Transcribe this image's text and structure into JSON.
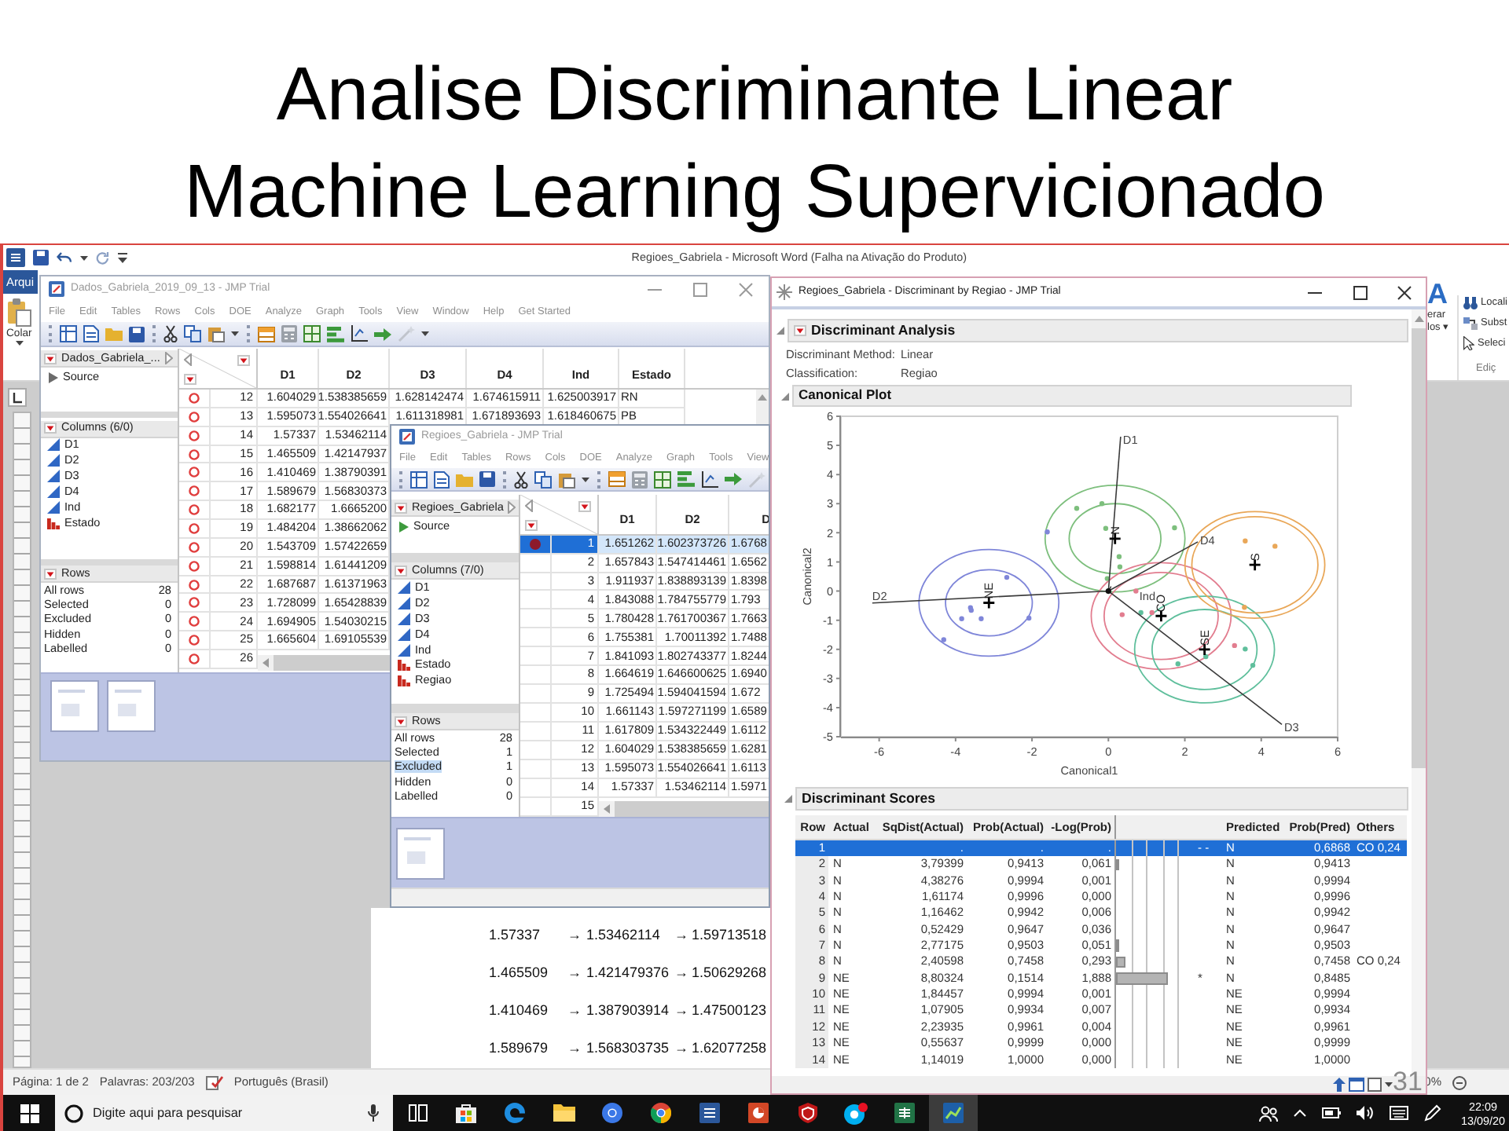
{
  "slide": {
    "title_lines": [
      "Analise Discriminante Linear",
      "Machine Learning Supervicionado"
    ],
    "slide_number": "31"
  },
  "word": {
    "title": "Regioes_Gabriela - Microsoft Word (Falha na Ativação do Produto)",
    "file_tab": "Arqui",
    "paste_label": "Colar",
    "styles_glyph": "A",
    "styles_label_lines": [
      "erar",
      "los ▾"
    ],
    "editing_items": [
      "Locali",
      "Subst",
      "Seleci"
    ],
    "editing_group": "Ediç",
    "document_lines": [
      [
        "1.57337",
        "→",
        "1.53462114",
        "→",
        "1.59713518"
      ],
      [
        "1.465509",
        "→",
        "1.421479376",
        "→",
        "1.50629268"
      ],
      [
        "1.410469",
        "→",
        "1.387903914",
        "→",
        "1.47500123"
      ],
      [
        "1.589679",
        "→",
        "1.568303735",
        "→",
        "1.62077258"
      ]
    ],
    "status_bar": {
      "page": "Página: 1 de 2",
      "words": "Palavras: 203/203",
      "language": "Português (Brasil)",
      "zoom": "0%"
    }
  },
  "data_window": {
    "title": "Dados_Gabriela_2019_09_13 - JMP Trial",
    "active": false,
    "menu": [
      "File",
      "Edit",
      "Tables",
      "Rows",
      "Cols",
      "DOE",
      "Analyze",
      "Graph",
      "Tools",
      "View",
      "Window",
      "Help",
      "Get Started"
    ],
    "table_name": "Dados_Gabriela_...",
    "source": "Source",
    "columns_header": "Columns (6/0)",
    "columns": [
      {
        "name": "D1",
        "kind": "continuous"
      },
      {
        "name": "D2",
        "kind": "continuous"
      },
      {
        "name": "D3",
        "kind": "continuous"
      },
      {
        "name": "D4",
        "kind": "continuous"
      },
      {
        "name": "Ind",
        "kind": "continuous"
      },
      {
        "name": "Estado",
        "kind": "nominal"
      }
    ],
    "rows_header": "Rows",
    "row_states": [
      {
        "label": "All rows",
        "value": "28",
        "selected": false
      },
      {
        "label": "Selected",
        "value": "0",
        "selected": false
      },
      {
        "label": "Excluded",
        "value": "0",
        "selected": false
      },
      {
        "label": "Hidden",
        "value": "0",
        "selected": false
      },
      {
        "label": "Labelled",
        "value": "0",
        "selected": false
      }
    ],
    "grid": {
      "columns": [
        "D1",
        "D2",
        "D3",
        "D4",
        "Ind",
        "Estado"
      ],
      "rows": [
        {
          "number": "12",
          "marker": true,
          "selected": false,
          "cells": [
            "1.604029",
            "1.538385659",
            "1.628142474",
            "1.674615911",
            "1.625003917",
            "RN"
          ]
        },
        {
          "number": "13",
          "marker": true,
          "selected": false,
          "cells": [
            "1.595073",
            "1.554026641",
            "1.611318981",
            "1.671893693",
            "1.618460675",
            "PB"
          ]
        },
        {
          "number": "14",
          "marker": true,
          "selected": false,
          "cells": [
            "1.57337",
            "1.53462114"
          ]
        },
        {
          "number": "15",
          "marker": true,
          "selected": false,
          "cells": [
            "1.465509",
            "1.42147937"
          ]
        },
        {
          "number": "16",
          "marker": true,
          "selected": false,
          "cells": [
            "1.410469",
            "1.38790391"
          ]
        },
        {
          "number": "17",
          "marker": true,
          "selected": false,
          "cells": [
            "1.589679",
            "1.56830373"
          ]
        },
        {
          "number": "18",
          "marker": true,
          "selected": false,
          "cells": [
            "1.682177",
            "1.6665200"
          ]
        },
        {
          "number": "19",
          "marker": true,
          "selected": false,
          "cells": [
            "1.484204",
            "1.38662062"
          ]
        },
        {
          "number": "20",
          "marker": true,
          "selected": false,
          "cells": [
            "1.543709",
            "1.57422659"
          ]
        },
        {
          "number": "21",
          "marker": true,
          "selected": false,
          "cells": [
            "1.598814",
            "1.61441209"
          ]
        },
        {
          "number": "22",
          "marker": true,
          "selected": false,
          "cells": [
            "1.687687",
            "1.61371963"
          ]
        },
        {
          "number": "23",
          "marker": true,
          "selected": false,
          "cells": [
            "1.728099",
            "1.65428839"
          ]
        },
        {
          "number": "24",
          "marker": true,
          "selected": false,
          "cells": [
            "1.694905",
            "1.54030215"
          ]
        },
        {
          "number": "25",
          "marker": true,
          "selected": false,
          "cells": [
            "1.665604",
            "1.69105539"
          ]
        },
        {
          "number": "26",
          "marker": true,
          "selected": false
        }
      ]
    }
  },
  "table_window": {
    "title": "Regioes_Gabriela - JMP Trial",
    "active": false,
    "menu": [
      "File",
      "Edit",
      "Tables",
      "Rows",
      "Cols",
      "DOE",
      "Analyze",
      "Graph",
      "Tools",
      "View"
    ],
    "table_name": "Regioes_Gabriela",
    "source": "Source",
    "columns_header": "Columns (7/0)",
    "columns": [
      {
        "name": "D1",
        "kind": "continuous"
      },
      {
        "name": "D2",
        "kind": "continuous"
      },
      {
        "name": "D3",
        "kind": "continuous"
      },
      {
        "name": "D4",
        "kind": "continuous"
      },
      {
        "name": "Ind",
        "kind": "continuous"
      },
      {
        "name": "Estado",
        "kind": "nominal"
      },
      {
        "name": "Regiao",
        "kind": "nominal"
      }
    ],
    "rows_header": "Rows",
    "row_states": [
      {
        "label": "All rows",
        "value": "28",
        "selected": false
      },
      {
        "label": "Selected",
        "value": "1",
        "selected": false
      },
      {
        "label": "Excluded",
        "value": "1",
        "selected": true
      },
      {
        "label": "Hidden",
        "value": "0",
        "selected": false
      },
      {
        "label": "Labelled",
        "value": "0",
        "selected": false
      }
    ],
    "grid": {
      "columns": [
        "D1",
        "D2",
        "D"
      ],
      "rows": [
        {
          "number": "1",
          "marker": true,
          "selected": true,
          "cells": [
            "1.651262",
            "1.602373726",
            "1.6768"
          ]
        },
        {
          "number": "2",
          "marker": false,
          "selected": false,
          "cells": [
            "1.657843",
            "1.547414461",
            "1.6562"
          ]
        },
        {
          "number": "3",
          "marker": false,
          "selected": false,
          "cells": [
            "1.911937",
            "1.838893139",
            "1.8398"
          ]
        },
        {
          "number": "4",
          "marker": false,
          "selected": false,
          "cells": [
            "1.843088",
            "1.784755779",
            "1.793"
          ]
        },
        {
          "number": "5",
          "marker": false,
          "selected": false,
          "cells": [
            "1.780428",
            "1.761700367",
            "1.7663"
          ]
        },
        {
          "number": "6",
          "marker": false,
          "selected": false,
          "cells": [
            "1.755381",
            "1.70011392",
            "1.7488"
          ]
        },
        {
          "number": "7",
          "marker": false,
          "selected": false,
          "cells": [
            "1.841093",
            "1.802743377",
            "1.8244"
          ]
        },
        {
          "number": "8",
          "marker": false,
          "selected": false,
          "cells": [
            "1.664619",
            "1.646600625",
            "1.6940"
          ]
        },
        {
          "number": "9",
          "marker": false,
          "selected": false,
          "cells": [
            "1.725494",
            "1.594041594",
            "1.672"
          ]
        },
        {
          "number": "10",
          "marker": false,
          "selected": false,
          "cells": [
            "1.661143",
            "1.597271199",
            "1.6589"
          ]
        },
        {
          "number": "11",
          "marker": false,
          "selected": false,
          "cells": [
            "1.617809",
            "1.534322449",
            "1.6112"
          ]
        },
        {
          "number": "12",
          "marker": false,
          "selected": false,
          "cells": [
            "1.604029",
            "1.538385659",
            "1.6281"
          ]
        },
        {
          "number": "13",
          "marker": false,
          "selected": false,
          "cells": [
            "1.595073",
            "1.554026641",
            "1.6113"
          ]
        },
        {
          "number": "14",
          "marker": false,
          "selected": false,
          "cells": [
            "1.57337",
            "1.53462114",
            "1.5971"
          ]
        },
        {
          "number": "15",
          "marker": false,
          "selected": false
        }
      ]
    }
  },
  "discriminant_window": {
    "title": "Regioes_Gabriela - Discriminant by Regiao - JMP Trial",
    "active": true,
    "analysis": {
      "title": "Discriminant Analysis",
      "fields": [
        {
          "label": "Discriminant Method:",
          "value": "Linear"
        },
        {
          "label": "Classification:",
          "value": "Regiao"
        }
      ]
    },
    "canonical_plot": {
      "title": "Canonical Plot",
      "chart_data": {
        "type": "scatter",
        "xlabel": "Canonical1",
        "ylabel": "Canonical2",
        "xlim": [
          -7,
          6
        ],
        "ylim": [
          -5,
          6
        ],
        "xticks": [
          -6,
          -4,
          -2,
          0,
          2,
          4,
          6
        ],
        "yticks": [
          -5,
          -4,
          -3,
          -2,
          -1,
          0,
          1,
          2,
          3,
          4,
          5,
          6
        ],
        "series": [
          {
            "name": "N",
            "color": "#7dbf7d",
            "x": [
              -0.83,
              -0.17,
              -0.07,
              0.28,
              0.3,
              1.73,
              -0.03
            ],
            "values": [
              2.84,
              3.0,
              2.15,
              1.18,
              0.83,
              2.17,
              0.43
            ]
          },
          {
            "name": "NE",
            "color": "#7f86d9",
            "x": [
              -1.6,
              -2.66,
              -3.61,
              -3.59,
              -3.84,
              -3.33,
              -2.08,
              -4.31
            ],
            "values": [
              2.03,
              0.47,
              -0.57,
              -0.66,
              -0.95,
              -0.95,
              -0.93,
              -1.67
            ]
          },
          {
            "name": "CO",
            "color": "#e27d8f",
            "x": [
              0.72,
              0.36,
              1.14,
              3.3
            ],
            "values": [
              0.0,
              -0.81,
              -0.74,
              -1.87
            ]
          },
          {
            "name": "SE",
            "color": "#5fbf9c",
            "x": [
              0.85,
              1.82,
              3.58,
              3.78,
              2.55
            ],
            "values": [
              -0.74,
              -2.5,
              -1.99,
              -2.55,
              -2.25
            ]
          },
          {
            "name": "S",
            "color": "#e9a758",
            "x": [
              3.56,
              3.58,
              4.36
            ],
            "values": [
              -0.56,
              1.72,
              1.54
            ]
          }
        ],
        "annotations": [
          "D1",
          "D2",
          "D3",
          "D4",
          "Ind"
        ]
      }
    },
    "scores": {
      "title": "Discriminant Scores",
      "columns": [
        "Row",
        "Actual",
        "SqDist(Actual)",
        "Prob(Actual)",
        "-Log(Prob)",
        "Predicted",
        "Prob(Pred)",
        "Others"
      ],
      "rows": [
        {
          "row": "1",
          "sqdist": ".",
          "prob": ".",
          "neg_log_prob": ".",
          "flag": "- -",
          "predicted": "N",
          "prob_pred": "0,6868",
          "others": "CO 0,24",
          "selected": true
        },
        {
          "row": "2",
          "actual": "N",
          "sqdist": "3,79399",
          "prob": "0,9413",
          "neg_log_prob": "0,061",
          "level": 0.02,
          "predicted": "N",
          "prob_pred": "0,9413",
          "selected": false
        },
        {
          "row": "3",
          "actual": "N",
          "sqdist": "4,38276",
          "prob": "0,9994",
          "neg_log_prob": "0,001",
          "level": 0,
          "predicted": "N",
          "prob_pred": "0,9994",
          "selected": false
        },
        {
          "row": "4",
          "actual": "N",
          "sqdist": "1,61174",
          "prob": "0,9996",
          "neg_log_prob": "0,000",
          "level": 0,
          "predicted": "N",
          "prob_pred": "0,9996",
          "selected": false
        },
        {
          "row": "5",
          "actual": "N",
          "sqdist": "1,16462",
          "prob": "0,9942",
          "neg_log_prob": "0,006",
          "level": 0,
          "predicted": "N",
          "prob_pred": "0,9942",
          "selected": false
        },
        {
          "row": "6",
          "actual": "N",
          "sqdist": "0,52429",
          "prob": "0,9647",
          "neg_log_prob": "0,036",
          "level": 0,
          "predicted": "N",
          "prob_pred": "0,9647",
          "selected": false
        },
        {
          "row": "7",
          "actual": "N",
          "sqdist": "2,77175",
          "prob": "0,9503",
          "neg_log_prob": "0,051",
          "level": 0.02,
          "predicted": "N",
          "prob_pred": "0,9503",
          "selected": false
        },
        {
          "row": "8",
          "actual": "N",
          "sqdist": "2,40598",
          "prob": "0,7458",
          "neg_log_prob": "0,293",
          "level": 0.12,
          "predicted": "N",
          "prob_pred": "0,7458",
          "others": "CO 0,24",
          "selected": false
        },
        {
          "row": "9",
          "actual": "NE",
          "sqdist": "8,80324",
          "prob": "0,1514",
          "neg_log_prob": "1,888",
          "level": 0.65,
          "flag": "*",
          "predicted": "N",
          "prob_pred": "0,8485",
          "selected": false
        },
        {
          "row": "10",
          "actual": "NE",
          "sqdist": "1,84457",
          "prob": "0,9994",
          "neg_log_prob": "0,001",
          "level": 0,
          "predicted": "NE",
          "prob_pred": "0,9994",
          "selected": false
        },
        {
          "row": "11",
          "actual": "NE",
          "sqdist": "1,07905",
          "prob": "0,9934",
          "neg_log_prob": "0,007",
          "level": 0,
          "predicted": "NE",
          "prob_pred": "0,9934",
          "selected": false
        },
        {
          "row": "12",
          "actual": "NE",
          "sqdist": "2,23935",
          "prob": "0,9961",
          "neg_log_prob": "0,004",
          "level": 0,
          "predicted": "NE",
          "prob_pred": "0,9961",
          "selected": false
        },
        {
          "row": "13",
          "actual": "NE",
          "sqdist": "0,55637",
          "prob": "0,9999",
          "neg_log_prob": "0,000",
          "level": 0,
          "predicted": "NE",
          "prob_pred": "0,9999",
          "selected": false
        },
        {
          "row": "14",
          "actual": "NE",
          "sqdist": "1,14019",
          "prob": "1,0000",
          "neg_log_prob": "0,000",
          "level": 0,
          "predicted": "NE",
          "prob_pred": "1,0000",
          "selected": false
        }
      ]
    }
  },
  "taskbar": {
    "search_placeholder": "Digite aqui para pesquisar",
    "apps": [
      {
        "kind": "task-view",
        "selected": false
      },
      {
        "kind": "store",
        "selected": false
      },
      {
        "kind": "edge",
        "selected": false
      },
      {
        "kind": "folder",
        "selected": false
      },
      {
        "kind": "browser",
        "selected": false
      },
      {
        "kind": "chrome",
        "selected": false
      },
      {
        "kind": "word",
        "selected": false
      },
      {
        "kind": "powerpoint",
        "selected": false
      },
      {
        "kind": "shield",
        "selected": false
      },
      {
        "kind": "skype",
        "selected": false
      },
      {
        "kind": "excel",
        "selected": false
      },
      {
        "kind": "jmp",
        "selected": true
      }
    ],
    "time": "22:09",
    "date": "13/09/20"
  }
}
